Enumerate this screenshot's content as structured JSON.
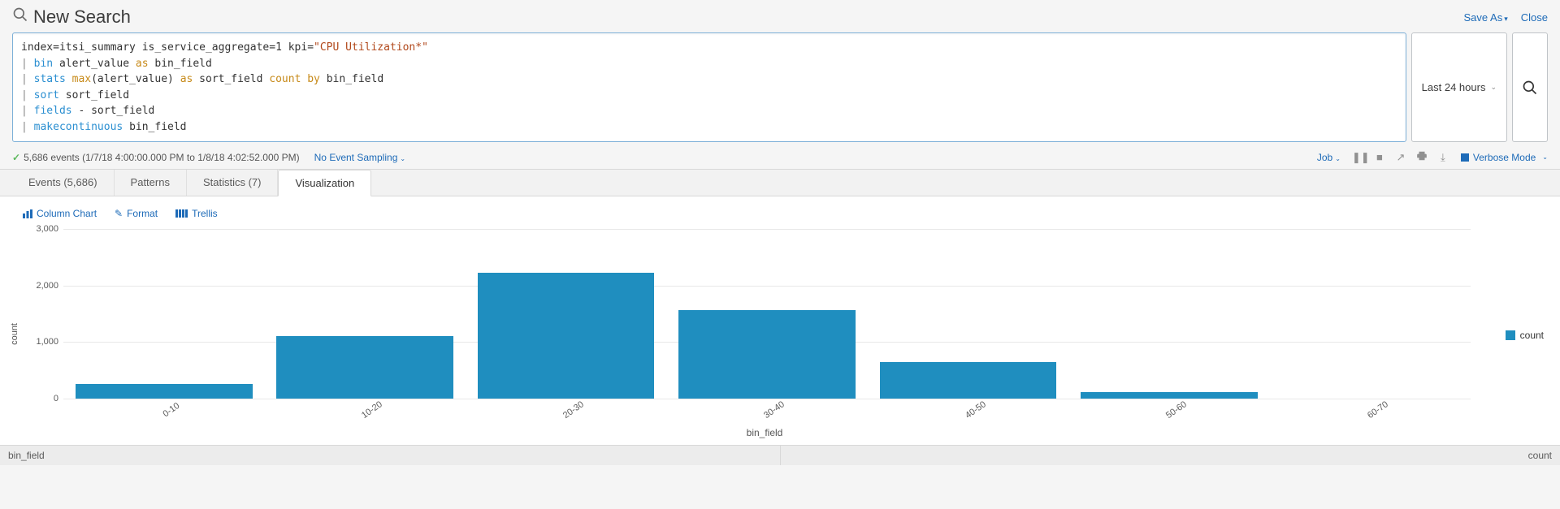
{
  "header": {
    "title": "New Search",
    "save_as": "Save As",
    "close": "Close"
  },
  "search": {
    "tokens": [
      [
        [
          "plain",
          "index=itsi_summary is_service_aggregate=1 kpi="
        ],
        [
          "str",
          "\"CPU Utilization*\""
        ]
      ],
      [
        [
          "pipe",
          "| "
        ],
        [
          "cmd",
          "bin "
        ],
        [
          "plain",
          "alert_value "
        ],
        [
          "kw",
          "as"
        ],
        [
          "plain",
          " bin_field"
        ]
      ],
      [
        [
          "pipe",
          "| "
        ],
        [
          "cmd",
          "stats "
        ],
        [
          "kw",
          "max"
        ],
        [
          "plain",
          "(alert_value) "
        ],
        [
          "kw",
          "as"
        ],
        [
          "plain",
          " sort_field "
        ],
        [
          "kw",
          "count"
        ],
        [
          "plain",
          " "
        ],
        [
          "kw",
          "by"
        ],
        [
          "plain",
          " bin_field"
        ]
      ],
      [
        [
          "pipe",
          "| "
        ],
        [
          "cmd",
          "sort "
        ],
        [
          "plain",
          "sort_field"
        ]
      ],
      [
        [
          "pipe",
          "| "
        ],
        [
          "cmd",
          "fields "
        ],
        [
          "plain",
          "- sort_field"
        ]
      ],
      [
        [
          "pipe",
          "| "
        ],
        [
          "cmd",
          "makecontinuous "
        ],
        [
          "plain",
          "bin_field"
        ]
      ]
    ],
    "time_range": "Last 24 hours"
  },
  "status": {
    "events_text": "5,686 events (1/7/18 4:00:00.000 PM to 1/8/18 4:02:52.000 PM)",
    "sampling": "No Event Sampling",
    "job_label": "Job",
    "mode": "Verbose Mode"
  },
  "tabs": {
    "events": "Events (5,686)",
    "patterns": "Patterns",
    "statistics": "Statistics (7)",
    "visualization": "Visualization"
  },
  "viz_toolbar": {
    "chart_type": "Column Chart",
    "format": "Format",
    "trellis": "Trellis"
  },
  "chart_data": {
    "type": "bar",
    "categories": [
      "0-10",
      "10-20",
      "20-30",
      "30-40",
      "40-50",
      "50-60",
      "60-70"
    ],
    "values": [
      260,
      1100,
      2230,
      1560,
      640,
      120,
      0
    ],
    "xlabel": "bin_field",
    "ylabel": "count",
    "ylim": [
      0,
      3000
    ],
    "y_ticks": [
      0,
      1000,
      2000,
      3000
    ],
    "y_tick_labels": [
      "0",
      "1,000",
      "2,000",
      "3,000"
    ],
    "legend": "count"
  },
  "footer": {
    "left": "bin_field",
    "right": "count"
  }
}
